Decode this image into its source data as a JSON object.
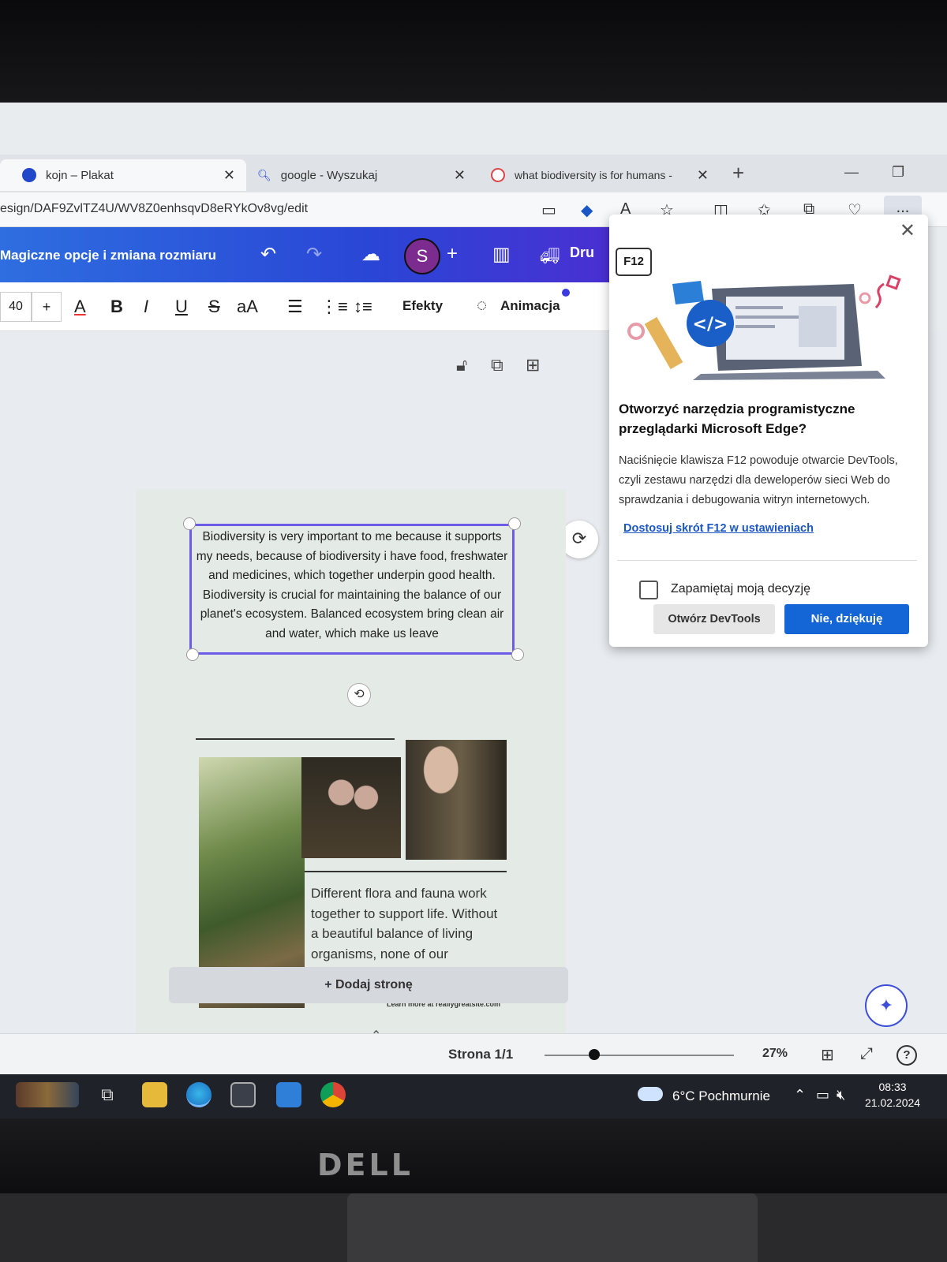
{
  "browser": {
    "tabs": [
      {
        "title": "kojn – Plakat",
        "active": true
      },
      {
        "title": "google - Wyszukaj",
        "active": false
      },
      {
        "title": "what biodiversity is for humans -",
        "active": false
      }
    ],
    "new_tab_label": "+",
    "address": "esign/DAF9ZvlTZ4U/WV8Z0enhsqvD8eRYkOv8vg/edit",
    "more_label": "..."
  },
  "canva": {
    "header": {
      "magic_label": "Magiczne opcje i zmiana rozmiaru",
      "avatar_letter": "S",
      "add_label": "+",
      "print_label": "Dru"
    },
    "toolbar": {
      "font_size": "40",
      "increase_label": "+",
      "color_label": "A",
      "bold_label": "B",
      "italic_label": "I",
      "underline_label": "U",
      "strike_label": "S",
      "case_label": "aA",
      "effects_label": "Efekty",
      "animate_label": "Animacja"
    },
    "poster": {
      "selected_text": "Biodiversity is very important to me because it supports my needs, because of biodiversity i have food, freshwater and medicines, which together underpin good health. Biodiversity is crucial for maintaining the balance of our planet's ecosystem. Balanced ecosystem bring clean air and water, which make us leave",
      "body_text": "Different flora and fauna work together to support life. Without a beautiful balance of living organisms, none of our ecosystems could thrive.",
      "learn_more": "Learn more at reallygreatsite.com"
    },
    "add_page_label": "+ Dodaj stronę",
    "footer": {
      "page_info": "Strona 1/1",
      "zoom": "27%",
      "zoom_fraction": 0.27
    }
  },
  "dialog": {
    "key_label": "F12",
    "title": "Otworzyć narzędzia programistyczne przeglądarki Microsoft Edge?",
    "body": "Naciśnięcie klawisza F12 powoduje otwarcie DevTools, czyli zestawu narzędzi dla deweloperów sieci Web do sprawdzania i debugowania witryn internetowych.",
    "link": "Dostosuj skrót F12 w ustawieniach",
    "checkbox_label": "Zapamiętaj moją decyzję",
    "open_button": "Otwórz DevTools",
    "decline_button": "Nie, dziękuję"
  },
  "taskbar": {
    "weather": "6°C Pochmurnie",
    "time": "08:33",
    "date": "21.02.2024"
  },
  "monitor_brand": "DELL",
  "colors": {
    "canva_header": "#2a46d6",
    "selection": "#6c5ce7",
    "primary_button": "#1465d6",
    "avatar": "#7b2c8e"
  }
}
